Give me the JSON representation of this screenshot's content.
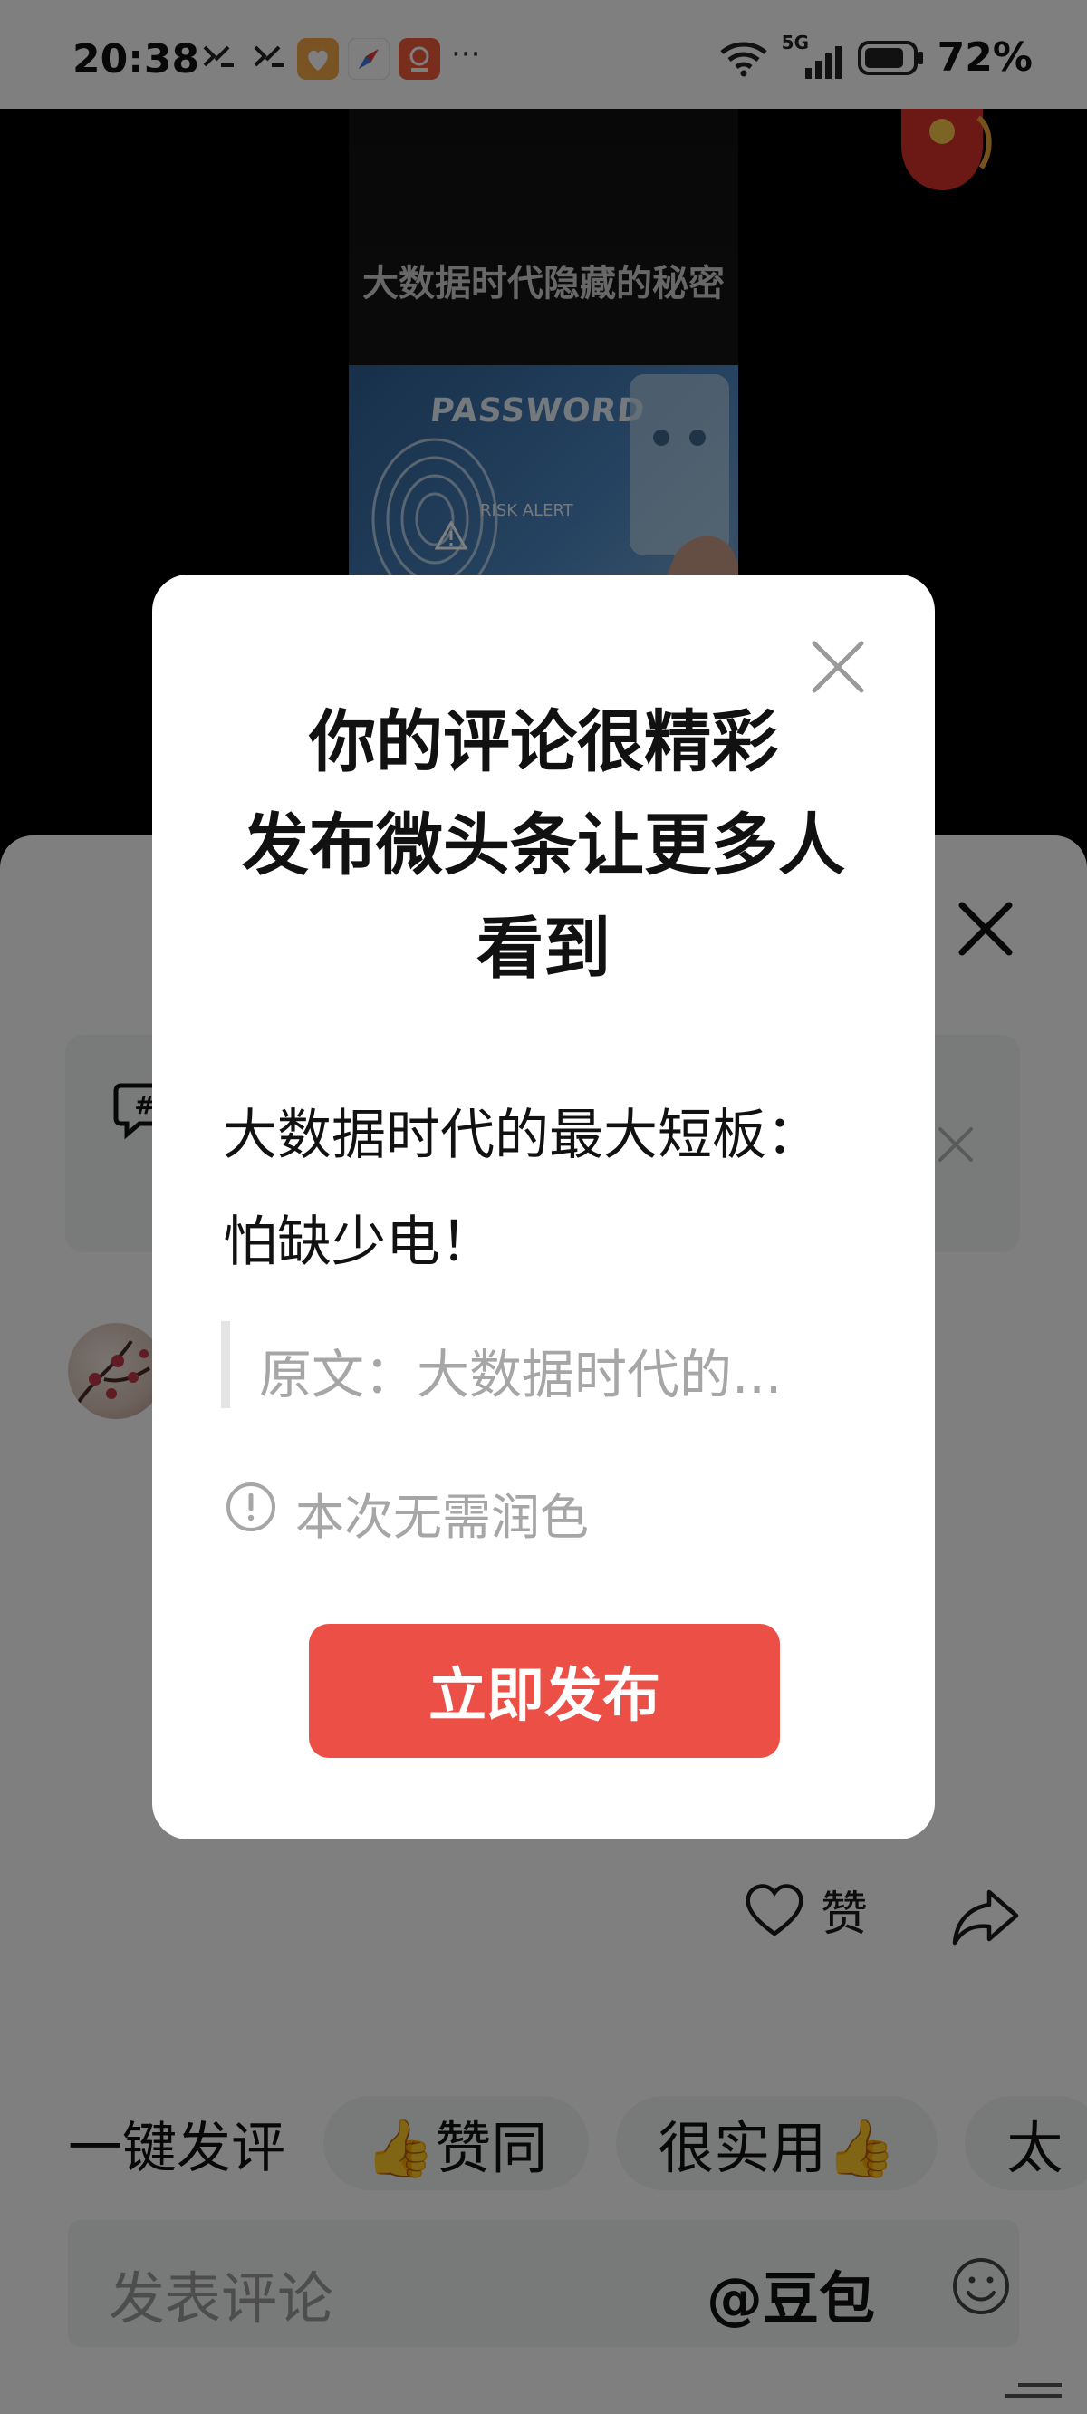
{
  "status_bar": {
    "time": "20:38",
    "network": "5G",
    "battery": "72%",
    "more": "···"
  },
  "video": {
    "title": "大数据时代隐藏的秘密",
    "thumb_text": "PASSWORD",
    "thumb_alert": "RISK ALERT"
  },
  "dialog": {
    "title_line1": "你的评论很精彩",
    "title_line2": "发布微头条让更多人",
    "title_line3": "看到",
    "comment_line1": "大数据时代的最大短板：",
    "comment_line2": "怕缺少电！",
    "quote": "原文：大数据时代的...",
    "info": "本次无需润色",
    "publish": "立即发布"
  },
  "panel": {
    "like_label": "赞",
    "quick_label": "一键发评",
    "chips": [
      "👍赞同",
      "很实用👍",
      "太"
    ],
    "comment_placeholder": "发表评论",
    "mention": "@豆包"
  },
  "colors": {
    "publish_button": "#ec4f45",
    "overlay": "rgba(0,0,0,0.5)"
  },
  "icons": [
    "close-icon",
    "info-icon",
    "heart-icon",
    "share-icon",
    "emoji-icon",
    "wifi-icon",
    "signal-icon",
    "battery-icon"
  ]
}
